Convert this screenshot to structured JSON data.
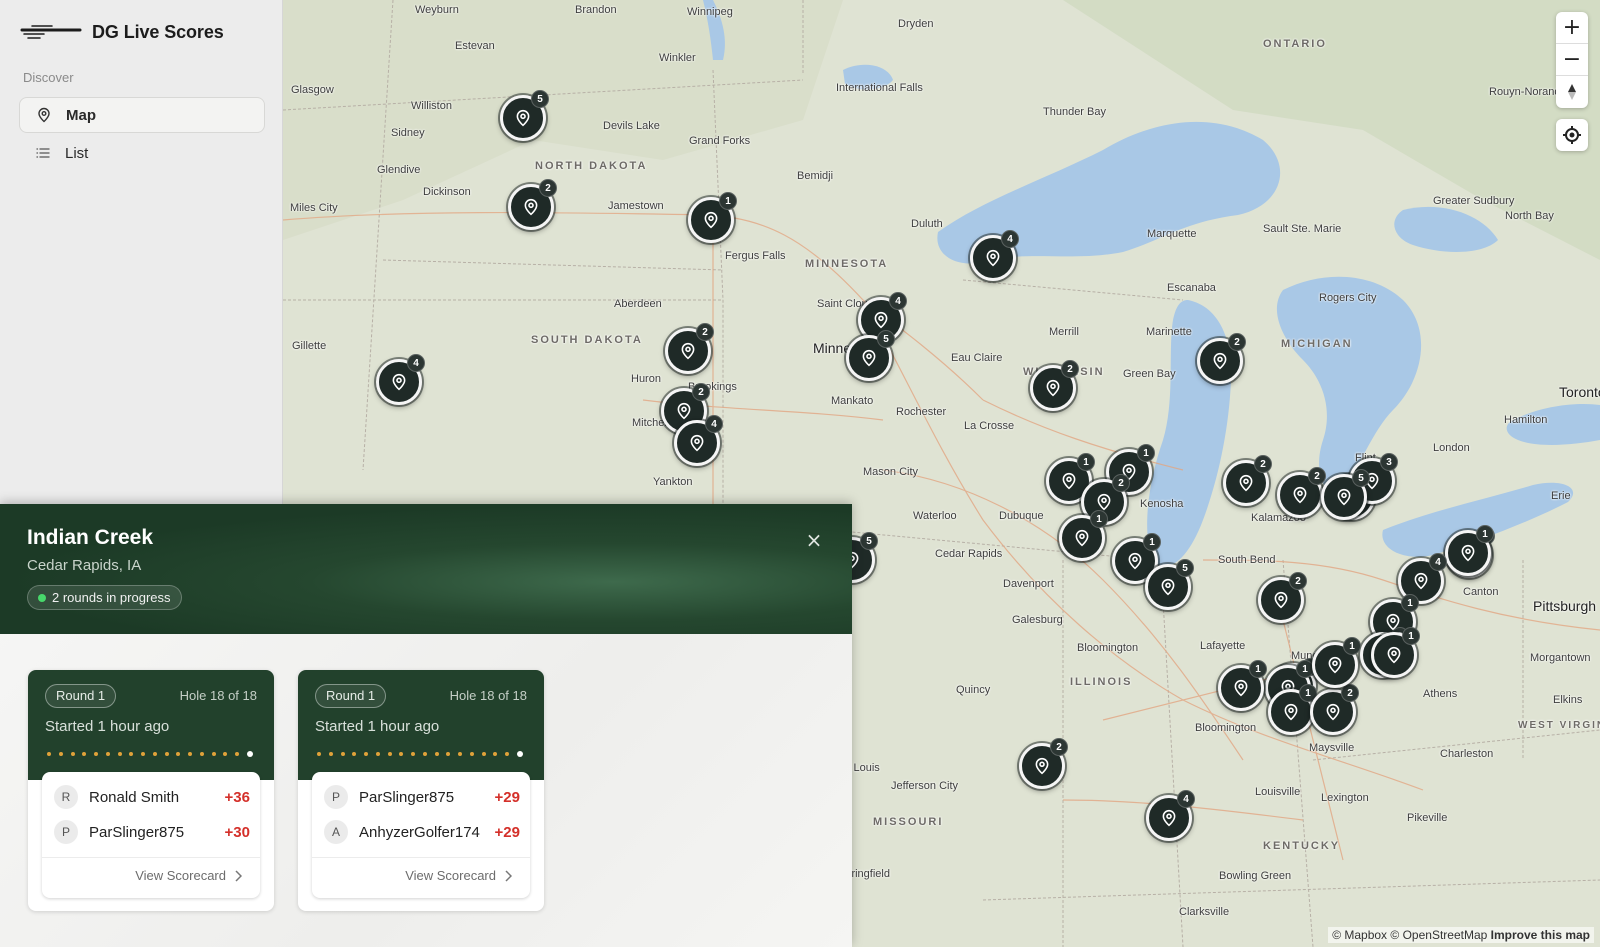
{
  "app": {
    "name": "DG Live Scores"
  },
  "sidebar": {
    "section_label": "Discover",
    "items": [
      {
        "label": "Map",
        "icon": "map-pin-icon",
        "active": true
      },
      {
        "label": "List",
        "icon": "list-icon",
        "active": false
      }
    ]
  },
  "map": {
    "places": [
      "Weyburn",
      "Brandon",
      "Winnipeg",
      "Dryden",
      "Estevan",
      "Winkler",
      "ONTARIO",
      "Rouyn-Noranda",
      "Glasgow",
      "Williston",
      "International Falls",
      "Thunder Bay",
      "Sidney",
      "Devils Lake",
      "Grand Forks",
      "NORTH DAKOTA",
      "Glendive",
      "Bemidji",
      "Dickinson",
      "Jamestown",
      "Greater Sudbury",
      "Miles City",
      "Duluth",
      "Sault Ste. Marie",
      "North Bay",
      "Fergus Falls",
      "MINNESOTA",
      "Marquette",
      "Escanaba",
      "Aberdeen",
      "Saint Cloud",
      "Rogers City",
      "SOUTH DAKOTA",
      "Merrill",
      "Marinette",
      "MICHIGAN",
      "Gillette",
      "Minneapolis",
      "Eau Claire",
      "Green Bay",
      "Toronto",
      "Huron",
      "Brookings",
      "Mankato",
      "WISCONSIN",
      "Rochester",
      "Hamilton",
      "Mitchell",
      "La Crosse",
      "London",
      "Mason City",
      "Flint",
      "Erie",
      "Yankton",
      "Waterloo",
      "Dubuque",
      "Kenosha",
      "Kalamazoo",
      "Canton",
      "Cedar Rapids",
      "Davenport",
      "South Bend",
      "Pittsburgh",
      "Galesburg",
      "Lafayette",
      "Bloomington",
      "Muncie",
      "Morgantown",
      "Quincy",
      "ILLINOIS",
      "Athens",
      "Elkins",
      "WEST VIRGINIA",
      "Bloomington",
      "Maysville",
      "Charleston",
      "St. Louis",
      "Jefferson City",
      "Louisville",
      "Lexington",
      "MISSOURI",
      "Pikeville",
      "KENTUCKY",
      "Springfield",
      "Bowling Green",
      "Clarksville"
    ],
    "zoom_in": "+",
    "zoom_out": "−",
    "attribution_mapbox": "© Mapbox",
    "attribution_osm": "© OpenStreetMap",
    "attribution_improve": "Improve this map",
    "clusters": [
      "5",
      "2",
      "1",
      "4",
      "4",
      "2",
      "4",
      "5",
      "2",
      "2",
      "2",
      "4",
      "2",
      "5",
      "1",
      "1",
      "2",
      "1",
      "1",
      "5",
      "2",
      "2",
      "1",
      "3",
      "2",
      "5",
      "1",
      "4",
      "1",
      "2",
      "1",
      "1",
      "1",
      "2",
      "2",
      "1",
      "1",
      "2",
      "4"
    ]
  },
  "course": {
    "name": "Indian Creek",
    "location": "Cedar Rapids, IA",
    "status": "2 rounds in progress",
    "close": "×"
  },
  "rounds": [
    {
      "round": "Round 1",
      "hole": "Hole 18 of 18",
      "started": "Started 1 hour ago",
      "players": [
        {
          "initial": "R",
          "name": "Ronald Smith",
          "score": "+36"
        },
        {
          "initial": "P",
          "name": "ParSlinger875",
          "score": "+30"
        }
      ],
      "link": "View Scorecard"
    },
    {
      "round": "Round 1",
      "hole": "Hole 18 of 18",
      "started": "Started 1 hour ago",
      "players": [
        {
          "initial": "P",
          "name": "ParSlinger875",
          "score": "+29"
        },
        {
          "initial": "A",
          "name": "AnhyzerGolfer174",
          "score": "+29"
        }
      ],
      "link": "View Scorecard"
    }
  ],
  "colors": {
    "panel_green": "#22412c",
    "score_red": "#d4302a",
    "live_dot": "#47d86b",
    "water": "#a9c8e6",
    "land": "#dfe3d3"
  }
}
